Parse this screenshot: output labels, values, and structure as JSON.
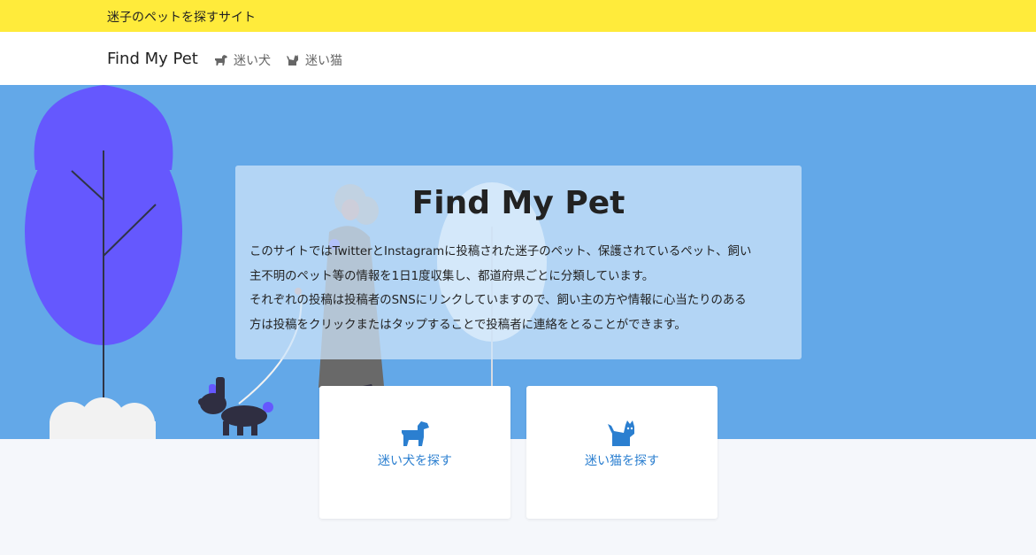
{
  "topbar": {
    "text": "迷子のペットを探すサイト"
  },
  "navbar": {
    "brand": "Find My Pet",
    "links": [
      {
        "label": "迷い犬",
        "icon": "dog-icon"
      },
      {
        "label": "迷い猫",
        "icon": "cat-icon"
      }
    ]
  },
  "hero": {
    "title": "Find My Pet",
    "description_lines": [
      "このサイトではTwitterとInstagramに投稿された迷子のペット、保護されているペット、飼い",
      "主不明のペット等の情報を1日1度収集し、都道府県ごとに分類しています。",
      "それぞれの投稿は投稿者のSNSにリンクしていますので、飼い主の方や情報に心当たりのある",
      "方は投稿をクリックまたはタップすることで投稿者に連絡をとることができます。"
    ]
  },
  "cards": [
    {
      "label": "迷い犬を探す",
      "icon": "dog-icon"
    },
    {
      "label": "迷い猫を探す",
      "icon": "cat-icon"
    }
  ],
  "colors": {
    "topbar": "#ffeb3b",
    "hero": "#63a8e8",
    "accent": "#2b7fd0",
    "tree": "#6558fe"
  }
}
